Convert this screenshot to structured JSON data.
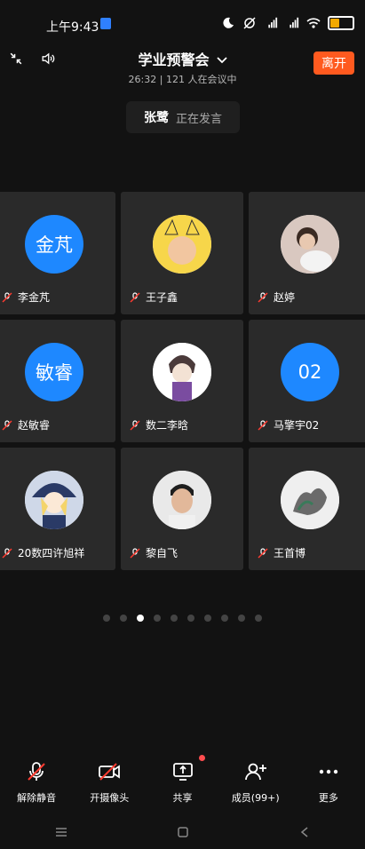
{
  "status": {
    "time": "上午9:43"
  },
  "header": {
    "title": "学业预警会",
    "duration": "26:32",
    "separator": "|",
    "attendees": "121 人在会议中",
    "leave_label": "离开"
  },
  "speaking": {
    "name": "张鹭",
    "status": "正在发言"
  },
  "participants": [
    {
      "name": "李金芃",
      "avatar_text": "金芃"
    },
    {
      "name": "王子鑫",
      "avatar_text": ""
    },
    {
      "name": "赵婷",
      "avatar_text": ""
    },
    {
      "name": "赵敏睿",
      "avatar_text": "敏睿"
    },
    {
      "name": "数二李晗",
      "avatar_text": ""
    },
    {
      "name": "马擎宇02",
      "avatar_text": "02"
    },
    {
      "name": "20数四许旭祥",
      "avatar_text": ""
    },
    {
      "name": "黎自飞",
      "avatar_text": ""
    },
    {
      "name": "王首博",
      "avatar_text": ""
    }
  ],
  "pagination": {
    "total": 10,
    "active_index": 2
  },
  "toolbar": {
    "unmute": "解除静音",
    "camera": "开摄像头",
    "share": "共享",
    "members": "成员(99+)",
    "more": "更多"
  },
  "colors": {
    "accent": "#ff5a1f",
    "avatar_blue": "#1e88ff",
    "mute_red": "#ff3b30"
  },
  "icons": {
    "collapse": "collapse-icon",
    "speaker": "speaker-icon",
    "chevron": "chevron-down-icon",
    "mic_off": "mic-off-icon",
    "camera_off": "camera-off-icon",
    "share": "share-screen-icon",
    "members": "members-add-icon",
    "more": "more-dots-icon"
  }
}
